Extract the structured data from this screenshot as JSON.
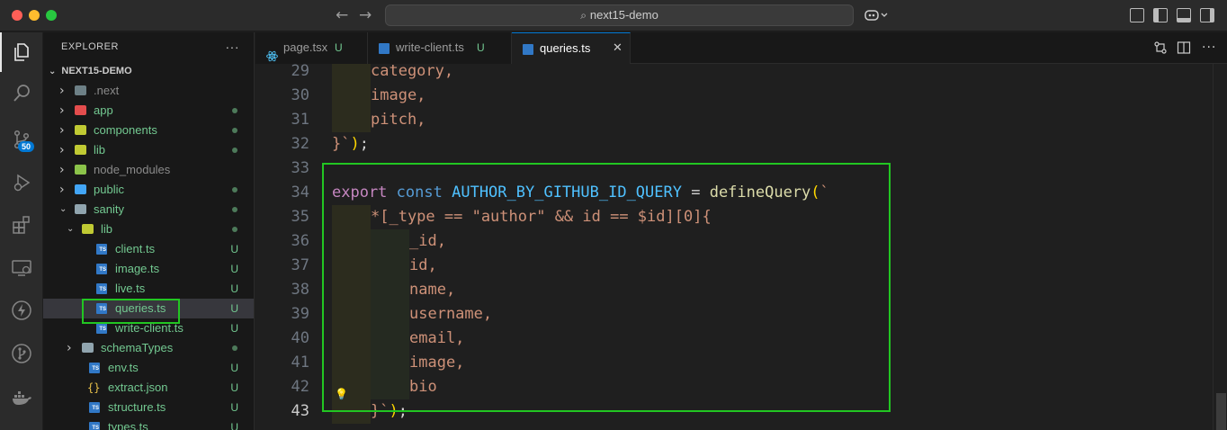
{
  "window": {
    "search_text": "next15-demo",
    "search_icon": "search-icon"
  },
  "activity_bar": {
    "items": [
      {
        "name": "explorer-icon"
      },
      {
        "name": "search-icon"
      },
      {
        "name": "source-control-icon",
        "badge": "50"
      },
      {
        "name": "run-debug-icon"
      },
      {
        "name": "extensions-icon"
      },
      {
        "name": "remote-explorer-icon"
      },
      {
        "name": "thunder-icon"
      },
      {
        "name": "git-graph-icon"
      },
      {
        "name": "docker-icon"
      }
    ]
  },
  "sidebar": {
    "header": "EXPLORER",
    "more": "···",
    "root": "NEXT15-DEMO",
    "items": [
      {
        "label": ".next",
        "depth": 0,
        "type": "folder",
        "expanded": false,
        "status": "",
        "dimmed": true,
        "icon_color": "#6d8086"
      },
      {
        "label": "app",
        "depth": 0,
        "type": "folder",
        "expanded": false,
        "status": "dot",
        "icon_color": "#e44d4d"
      },
      {
        "label": "components",
        "depth": 0,
        "type": "folder",
        "expanded": false,
        "status": "dot",
        "icon_color": "#c0ca33"
      },
      {
        "label": "lib",
        "depth": 0,
        "type": "folder",
        "expanded": false,
        "status": "dot",
        "icon_color": "#c0ca33"
      },
      {
        "label": "node_modules",
        "depth": 0,
        "type": "folder",
        "expanded": false,
        "status": "",
        "dimmed": true,
        "icon_color": "#8bc34a"
      },
      {
        "label": "public",
        "depth": 0,
        "type": "folder",
        "expanded": false,
        "status": "dot",
        "icon_color": "#42a5f5"
      },
      {
        "label": "sanity",
        "depth": 0,
        "type": "folder",
        "expanded": true,
        "status": "dot",
        "icon_color": "#90a4ae"
      },
      {
        "label": "lib",
        "depth": 1,
        "type": "folder",
        "expanded": true,
        "status": "dot",
        "icon_color": "#c0ca33"
      },
      {
        "label": "client.ts",
        "depth": 2,
        "type": "ts",
        "status": "U"
      },
      {
        "label": "image.ts",
        "depth": 2,
        "type": "ts",
        "status": "U"
      },
      {
        "label": "live.ts",
        "depth": 2,
        "type": "ts",
        "status": "U"
      },
      {
        "label": "queries.ts",
        "depth": 2,
        "type": "ts",
        "status": "U",
        "selected": true
      },
      {
        "label": "write-client.ts",
        "depth": 2,
        "type": "ts",
        "status": "U"
      },
      {
        "label": "schemaTypes",
        "depth": 1,
        "type": "folder",
        "expanded": false,
        "status": "dot",
        "icon_color": "#90a4ae"
      },
      {
        "label": "env.ts",
        "depth": 1,
        "type": "ts",
        "status": "U"
      },
      {
        "label": "extract.json",
        "depth": 1,
        "type": "json",
        "status": "U"
      },
      {
        "label": "structure.ts",
        "depth": 1,
        "type": "ts",
        "status": "U"
      },
      {
        "label": "types.ts",
        "depth": 1,
        "type": "ts",
        "status": "U"
      }
    ]
  },
  "tabs": [
    {
      "label": "page.tsx",
      "status": "U",
      "icon": "react-icon",
      "active": false
    },
    {
      "label": "write-client.ts",
      "status": "U",
      "icon": "typescript-icon",
      "active": false
    },
    {
      "label": "queries.ts",
      "status": "",
      "icon": "typescript-icon",
      "active": true,
      "close": "✕"
    }
  ],
  "editor": {
    "lines": [
      {
        "n": "29",
        "tokens": [
          {
            "t": "category,",
            "c": "k-str"
          }
        ],
        "indent": 1
      },
      {
        "n": "30",
        "tokens": [
          {
            "t": "image,",
            "c": "k-str"
          }
        ],
        "indent": 1
      },
      {
        "n": "31",
        "tokens": [
          {
            "t": "pitch,",
            "c": "k-str"
          }
        ],
        "indent": 1
      },
      {
        "n": "32",
        "tokens": [
          {
            "t": "}`",
            "c": "k-str"
          },
          {
            "t": ")",
            "c": "k-paren"
          },
          {
            "t": ";",
            "c": "k-plain"
          }
        ],
        "indent": 0
      },
      {
        "n": "33",
        "tokens": [],
        "indent": 0
      },
      {
        "n": "34",
        "tokens": [
          {
            "t": "export",
            "c": "k-export"
          },
          {
            "t": " ",
            "c": "k-plain"
          },
          {
            "t": "const",
            "c": "k-const"
          },
          {
            "t": " ",
            "c": "k-plain"
          },
          {
            "t": "AUTHOR_BY_GITHUB_ID_QUERY",
            "c": "k-var"
          },
          {
            "t": " = ",
            "c": "k-plain"
          },
          {
            "t": "defineQuery",
            "c": "k-fn"
          },
          {
            "t": "(",
            "c": "k-paren"
          },
          {
            "t": "`",
            "c": "k-str"
          }
        ],
        "indent": 0
      },
      {
        "n": "35",
        "tokens": [
          {
            "t": "*[_type == \"author\" && id == $id][0]{",
            "c": "k-str"
          }
        ],
        "indent": 1
      },
      {
        "n": "36",
        "tokens": [
          {
            "t": "_id,",
            "c": "k-str"
          }
        ],
        "indent": 2
      },
      {
        "n": "37",
        "tokens": [
          {
            "t": "id,",
            "c": "k-str"
          }
        ],
        "indent": 2
      },
      {
        "n": "38",
        "tokens": [
          {
            "t": "name,",
            "c": "k-str"
          }
        ],
        "indent": 2
      },
      {
        "n": "39",
        "tokens": [
          {
            "t": "username,",
            "c": "k-str"
          }
        ],
        "indent": 2
      },
      {
        "n": "40",
        "tokens": [
          {
            "t": "email,",
            "c": "k-str"
          }
        ],
        "indent": 2
      },
      {
        "n": "41",
        "tokens": [
          {
            "t": "image,",
            "c": "k-str"
          }
        ],
        "indent": 2
      },
      {
        "n": "42",
        "tokens": [
          {
            "t": "bio",
            "c": "k-str"
          }
        ],
        "indent": 2
      },
      {
        "n": "43",
        "tokens": [
          {
            "t": "}`",
            "c": "k-str"
          },
          {
            "t": ")",
            "c": "k-paren"
          },
          {
            "t": ";",
            "c": "k-plain"
          }
        ],
        "indent": 1,
        "current": true
      }
    ]
  }
}
